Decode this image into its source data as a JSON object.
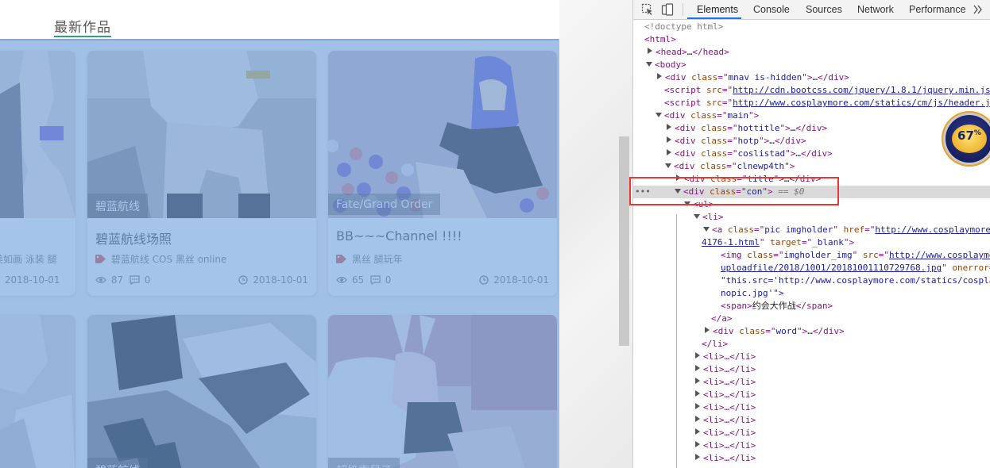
{
  "site": {
    "section_title": "最新作品",
    "cards": [
      {
        "id": "card-0",
        "category": "",
        "title": "",
        "tags": "美如画 泳装 腿",
        "views": "",
        "comments": "",
        "date": "2018-10-01",
        "partial": true
      },
      {
        "id": "card-1",
        "category": "碧蓝航线",
        "title": "碧蓝航线场照",
        "tags": "碧蓝航线 COS 黑丝 online",
        "views": "87",
        "comments": "0",
        "date": "2018-10-01"
      },
      {
        "id": "card-2",
        "category": "Fate/Grand Order",
        "title": "BB~~~Channel !!!!",
        "tags": "黑丝 腿玩年",
        "views": "65",
        "comments": "0",
        "date": "2018-10-01"
      },
      {
        "id": "card-3",
        "category": "",
        "title": "",
        "tags": "",
        "views": "",
        "comments": "",
        "date": ""
      },
      {
        "id": "card-4",
        "category": "碧蓝航线",
        "title": "",
        "tags": "",
        "views": "",
        "comments": "",
        "date": ""
      },
      {
        "id": "card-5",
        "category": "超级索尼子",
        "title": "",
        "tags": "",
        "views": "",
        "comments": "",
        "date": ""
      }
    ]
  },
  "devtools": {
    "tabs": [
      "Elements",
      "Console",
      "Sources",
      "Network",
      "Performance"
    ],
    "active_tab": "Elements",
    "badge_value": "67",
    "badge_unit": "%",
    "lines": {
      "l0": "<!doctype html>",
      "l1": "html",
      "l2": "head",
      "l3": "body",
      "l4_class": "mnav is-hidden",
      "l5_src": "http://cdn.bootcss.com/jquery/1.8.1/jquery.min.js",
      "l6_src": "http://www.cosplaymore.com/statics/cm/js/header.js",
      "l7_class": "main",
      "l8_class": "hottitle",
      "l9_class": "hotp",
      "l10_class": "coslistad",
      "l11_class": "clnewp4th",
      "l12_class": "title",
      "l13_class": "con",
      "l13_suffix": "== $0",
      "l14": "ul",
      "l15": "li",
      "l16_class": "pic imgholder",
      "l16_href": "http://www.cosplaymore.",
      "l16_href_cont": "4176-1.html",
      "l16_target": "_blank",
      "l17_class": "imgholder_img",
      "l17_src": "http://www.cosplaymo",
      "l17_src_cont": "uploadfile/2018/1001/20181001110729768.jpg",
      "l17_onerror": "onerror=",
      "l17_onerror_val": "\"this.src='http://www.cosplaymore.com/statics/cospla",
      "l17_onerror_end": "nopic.jpg'\">",
      "l18_text": "约会大作战",
      "l19": "a",
      "l20_class": "word",
      "l21": "li",
      "li_collapsed": "<li>…</li>"
    }
  }
}
